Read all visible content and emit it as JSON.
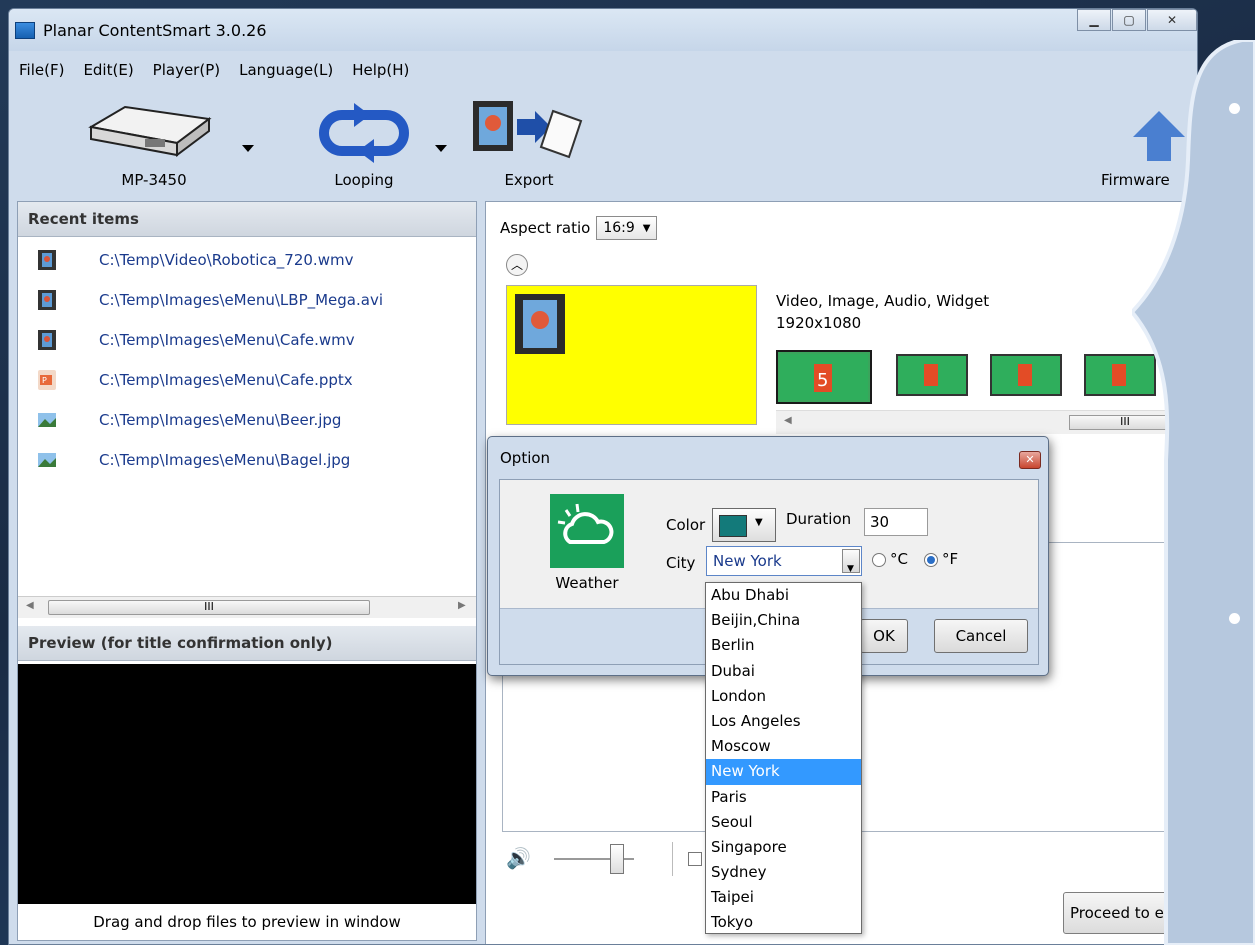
{
  "window": {
    "title": "Planar ContentSmart 3.0.26",
    "controls": [
      "minimize",
      "maximize",
      "close"
    ]
  },
  "menu": [
    "File(F)",
    "Edit(E)",
    "Player(P)",
    "Language(L)",
    "Help(H)"
  ],
  "toolbar": {
    "player_label": "MP-3450",
    "loop_label": "Looping",
    "export_label": "Export",
    "firmware_label": "Firmware"
  },
  "recent": {
    "header": "Recent items",
    "items": [
      {
        "path": "C:\\Temp\\Video\\Robotica_720.wmv",
        "icon": "video-file-icon"
      },
      {
        "path": "C:\\Temp\\Images\\eMenu\\LBP_Mega.avi",
        "icon": "video-file-icon"
      },
      {
        "path": "C:\\Temp\\Images\\eMenu\\Cafe.wmv",
        "icon": "video-file-icon"
      },
      {
        "path": "C:\\Temp\\Images\\eMenu\\Cafe.pptx",
        "icon": "powerpoint-file-icon"
      },
      {
        "path": "C:\\Temp\\Images\\eMenu\\Beer.jpg",
        "icon": "image-file-icon"
      },
      {
        "path": "C:\\Temp\\Images\\eMenu\\Bagel.jpg",
        "icon": "image-file-icon"
      }
    ],
    "scroll_grip": "III"
  },
  "preview": {
    "header": "Preview (for title confirmation only)",
    "caption": "Drag and drop files to preview in window"
  },
  "layout": {
    "aspect_label": "Aspect ratio",
    "aspect_value": "16:9",
    "content_types": "Video, Image, Audio, Widget",
    "resolution": "1920x1080",
    "scroll_grip": "III"
  },
  "bottom": {
    "proceed_label": "Proceed to ex"
  },
  "dialog": {
    "title": "Option",
    "widget_name": "Weather",
    "color_label": "Color",
    "color_value": "#137a7a",
    "duration_label": "Duration",
    "duration_value": "30",
    "city_label": "City",
    "city_value": "New York",
    "unit_c": "°C",
    "unit_f": "°F",
    "unit_selected": "°F",
    "ok_label": "OK",
    "cancel_label": "Cancel"
  },
  "city_options": [
    "Abu Dhabi",
    "Beijin,China",
    "Berlin",
    "Dubai",
    "London",
    "Los Angeles",
    "Moscow",
    "New York",
    "Paris",
    "Seoul",
    "Singapore",
    "Sydney",
    "Taipei",
    "Tokyo"
  ],
  "colors": {
    "accent_selection": "#3399ff",
    "preview_area": "#ffff00",
    "weather_tile": "#1aa05a"
  }
}
